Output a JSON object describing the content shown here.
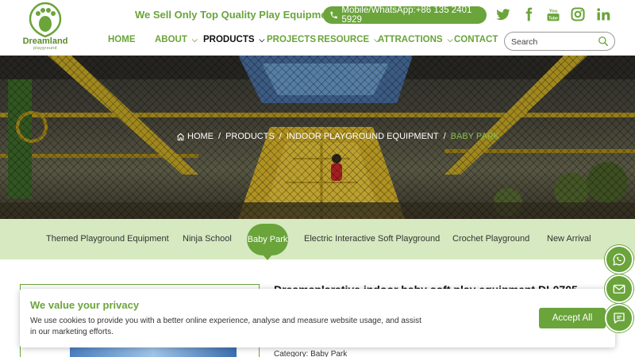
{
  "brand": {
    "name": "Dreamland",
    "sub": "playground",
    "color": "#6aa43a"
  },
  "header": {
    "tagline": "We Sell Only Top Quality Play Equipment",
    "phone": "Mobile/WhatsApp:+86 135 2401 5929",
    "social": [
      "twitter-icon",
      "facebook-icon",
      "youtube-icon",
      "instagram-icon",
      "linkedin-icon"
    ]
  },
  "nav": {
    "items": [
      {
        "label": "HOME"
      },
      {
        "label": "ABOUT"
      },
      {
        "label": "PRODUCTS"
      },
      {
        "label": "PROJECTS"
      },
      {
        "label": "RESOURCE"
      },
      {
        "label": "ATTRACTIONS"
      },
      {
        "label": "CONTACT"
      }
    ],
    "active": "PRODUCTS"
  },
  "search": {
    "placeholder": "Search",
    "value": ""
  },
  "breadcrumb": {
    "items": [
      "HOME",
      "PRODUCTS",
      "INDOOR PLAYGROUND EQUIPMENT",
      "BABY PARK"
    ],
    "separator": "/"
  },
  "categories": {
    "items": [
      "Themed Playground Equipment",
      "Ninja School",
      "Baby Park",
      "Electric Interactive Soft Playground",
      "Crochet Playground",
      "New Arrival"
    ],
    "active": "Baby Park"
  },
  "product": {
    "title": "Dreamsplarative indoor baby soft play equipment DL0705",
    "category": "Category: Baby Park"
  },
  "cookie": {
    "title": "We value your privacy",
    "text": "We use cookies to provide you with a better online experience, analyse and measure website usage, and assist in our marketing efforts.",
    "accept": "Accept All"
  },
  "floating": [
    "whatsapp-icon",
    "email-icon",
    "message-icon"
  ]
}
